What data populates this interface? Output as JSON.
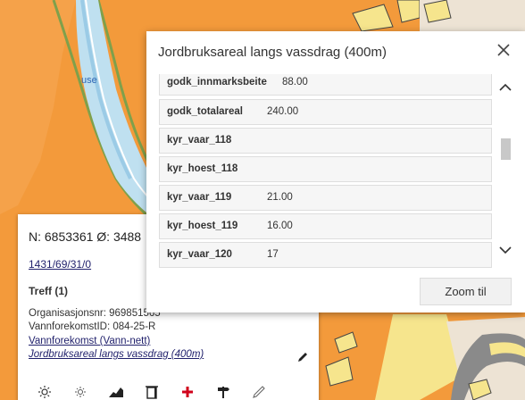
{
  "map": {
    "place_label": "use",
    "colors": {
      "agricultural": "#f39a3b",
      "river": "#a9d7ef",
      "buildings": "#f6e58d"
    }
  },
  "info_panel": {
    "coords": "N: 6853361 Ø: 3488",
    "property_link": "1431/69/31/0",
    "hits": "Treff (1)",
    "org_nr": "Organisasjonsnr: 969851565",
    "water_body_id": "VannforekomstID: 084-25-R",
    "water_body_link": "Vannforekomst (Vann-nett)",
    "layer_link": "Jordbruksareal langs vassdrag (400m)",
    "toolbar_icons": [
      "sun-icon",
      "sun-outline-icon",
      "elevation-profile-icon",
      "frame-icon",
      "red-cross-icon",
      "signpost-icon",
      "pencil-icon"
    ]
  },
  "dialog": {
    "title": "Jordbruksareal langs vassdrag (400m)",
    "rows": [
      {
        "key": "godk_innmarksbeite",
        "value": "88.00"
      },
      {
        "key": "godk_totalareal",
        "value": "240.00"
      },
      {
        "key": "kyr_vaar_118",
        "value": ""
      },
      {
        "key": "kyr_hoest_118",
        "value": ""
      },
      {
        "key": "kyr_vaar_119",
        "value": "21.00"
      },
      {
        "key": "kyr_hoest_119",
        "value": "16.00"
      },
      {
        "key": "kyr_vaar_120",
        "value": "17"
      }
    ],
    "zoom_button": "Zoom til"
  }
}
